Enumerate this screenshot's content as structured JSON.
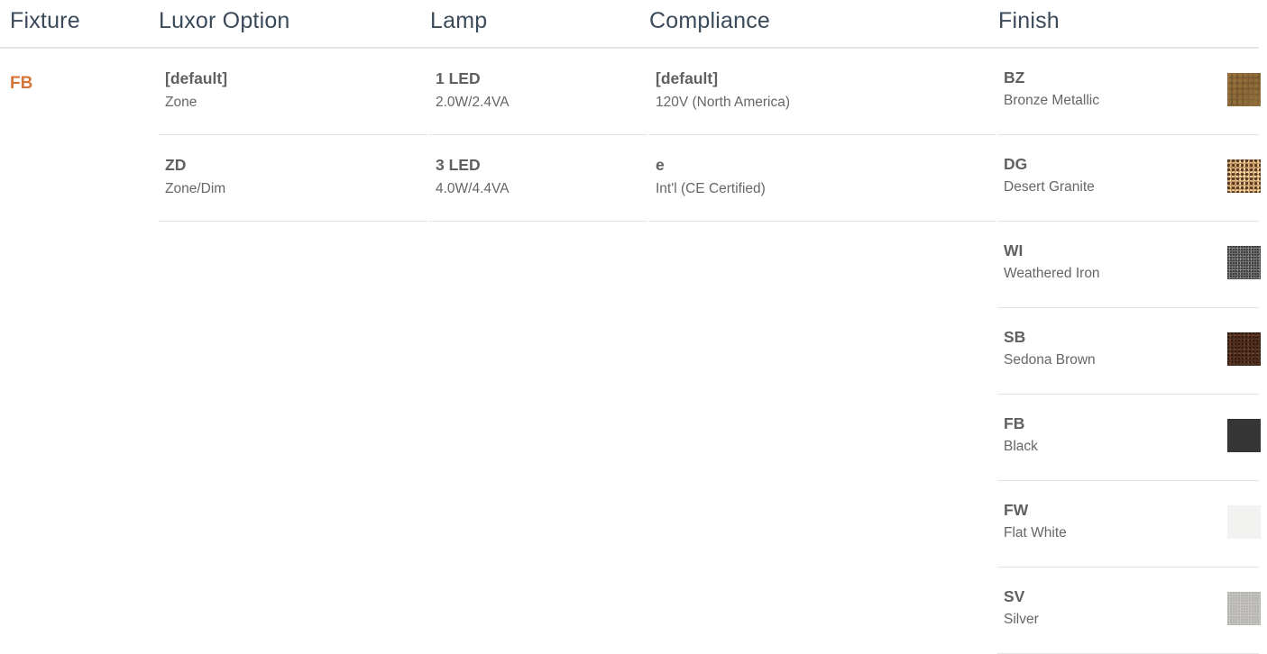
{
  "headers": {
    "fixture": "Fixture",
    "luxor_option": "Luxor Option",
    "lamp": "Lamp",
    "compliance": "Compliance",
    "finish": "Finish"
  },
  "fixture": {
    "code": "FB",
    "accent_color": "#d4753a"
  },
  "luxor_options": [
    {
      "code": "[default]",
      "desc": "Zone"
    },
    {
      "code": "ZD",
      "desc": "Zone/Dim"
    }
  ],
  "lamps": [
    {
      "code": "1 LED",
      "desc": "2.0W/2.4VA"
    },
    {
      "code": "3 LED",
      "desc": "4.0W/4.4VA"
    }
  ],
  "compliance": [
    {
      "code": "[default]",
      "desc": "120V (North America)"
    },
    {
      "code": "e",
      "desc": "Int'l (CE Certified)"
    }
  ],
  "finishes": [
    {
      "code": "BZ",
      "desc": "Bronze Metallic",
      "swatch": "#7f6038"
    },
    {
      "code": "DG",
      "desc": "Desert Granite",
      "swatch": "#c9955e"
    },
    {
      "code": "WI",
      "desc": "Weathered Iron",
      "swatch": "#6b6b6b"
    },
    {
      "code": "SB",
      "desc": "Sedona Brown",
      "swatch": "#4e2e1f"
    },
    {
      "code": "FB",
      "desc": "Black",
      "swatch": "#353535"
    },
    {
      "code": "FW",
      "desc": "Flat White",
      "swatch": "#f2f2f1"
    },
    {
      "code": "SV",
      "desc": "Silver",
      "swatch": "#c2c0bd"
    }
  ]
}
